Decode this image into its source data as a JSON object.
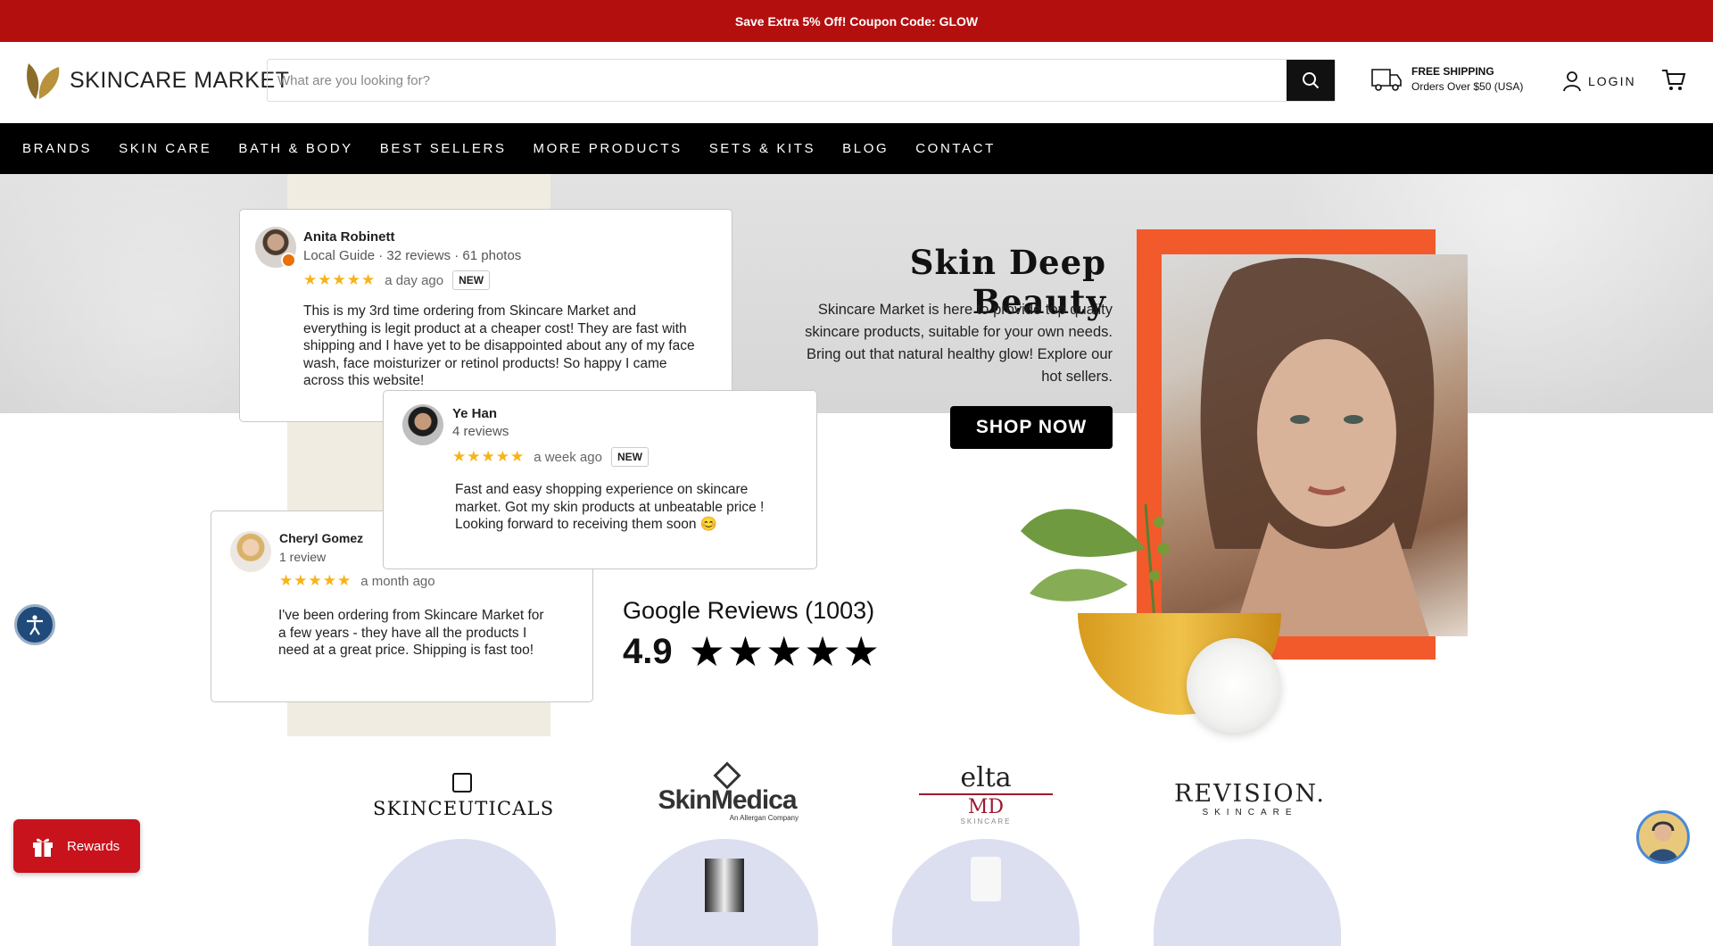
{
  "announcement": "Save Extra 5% Off! Coupon Code: GLOW",
  "header": {
    "logo_text": "SKINCARE MARKET",
    "search_placeholder": "What are you looking for?",
    "shipping_title": "FREE SHIPPING",
    "shipping_sub": "Orders Over $50 (USA)",
    "login_label": "LOGIN"
  },
  "nav": [
    "BRANDS",
    "SKIN CARE",
    "BATH & BODY",
    "BEST SELLERS",
    "MORE PRODUCTS",
    "SETS & KITS",
    "BLOG",
    "CONTACT"
  ],
  "reviews": [
    {
      "name": "Anita Robinett",
      "meta": "Local Guide · 32 reviews · 61 photos",
      "stars": "★★★★★",
      "age": "a day ago",
      "badge": "NEW",
      "text": "This is my 3rd time ordering from Skincare Market and everything is legit product at a cheaper cost! They are fast with shipping and I have yet to be disappointed about any of my face wash, face moisturizer or retinol products! So happy I came across this website!"
    },
    {
      "name": "Ye Han",
      "meta": "4 reviews",
      "stars": "★★★★★",
      "age": "a week ago",
      "badge": "NEW",
      "text": "Fast and easy shopping experience on skincare market. Got my skin products at unbeatable price ! Looking forward to receiving them soon 😊"
    },
    {
      "name": "Cheryl Gomez",
      "meta": "1 review",
      "stars": "★★★★★",
      "age": "a month ago",
      "text": "I've been ordering from Skincare Market for a few years - they have all the products I need at a great price. Shipping is fast too!"
    }
  ],
  "google_reviews": {
    "title": "Google Reviews (1003)",
    "rating": "4.9",
    "stars": "★★★★★"
  },
  "hero": {
    "title": "Skin Deep Beauty",
    "description": "Skincare Market is here to provide top quality skincare products, suitable for your own needs. Bring out that natural healthy glow! Explore our hot sellers.",
    "cta": "SHOP NOW"
  },
  "brands": [
    {
      "name": "SKINCEUTICALS"
    },
    {
      "name": "SkinMedica",
      "sub": "An Allergan Company"
    },
    {
      "name": "elta",
      "name2": "MD",
      "sub": "SKINCARE"
    },
    {
      "name": "REVISION.",
      "sub": "SKINCARE"
    }
  ],
  "rewards_label": "Rewards"
}
